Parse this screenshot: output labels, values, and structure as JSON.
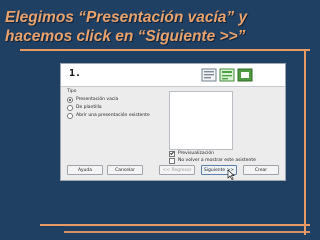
{
  "slide": {
    "title_line1": "Elegimos “Presentación vacía” y",
    "title_line2": "hacemos click en “Siguiente >>”"
  },
  "dialog": {
    "step": "1.",
    "type_label": "Tipo",
    "options": [
      {
        "label": "Presentación vacía",
        "selected": true
      },
      {
        "label": "De plantilla",
        "selected": false
      },
      {
        "label": "Abrir una presentación existente",
        "selected": false
      }
    ],
    "checkboxes": [
      {
        "label": "Previsualización",
        "checked": true
      },
      {
        "label": "No volver a mostrar este asistente",
        "checked": false
      }
    ],
    "buttons": {
      "help": "Ayuda",
      "cancel": "Cancelar",
      "back": "<< Regresar",
      "next": "Siguiente >>",
      "create": "Crear"
    }
  },
  "colors": {
    "background": "#1f3f63",
    "title": "#e9a26c",
    "accent_line": "#e79a64",
    "dialog_bg": "#ececec"
  }
}
